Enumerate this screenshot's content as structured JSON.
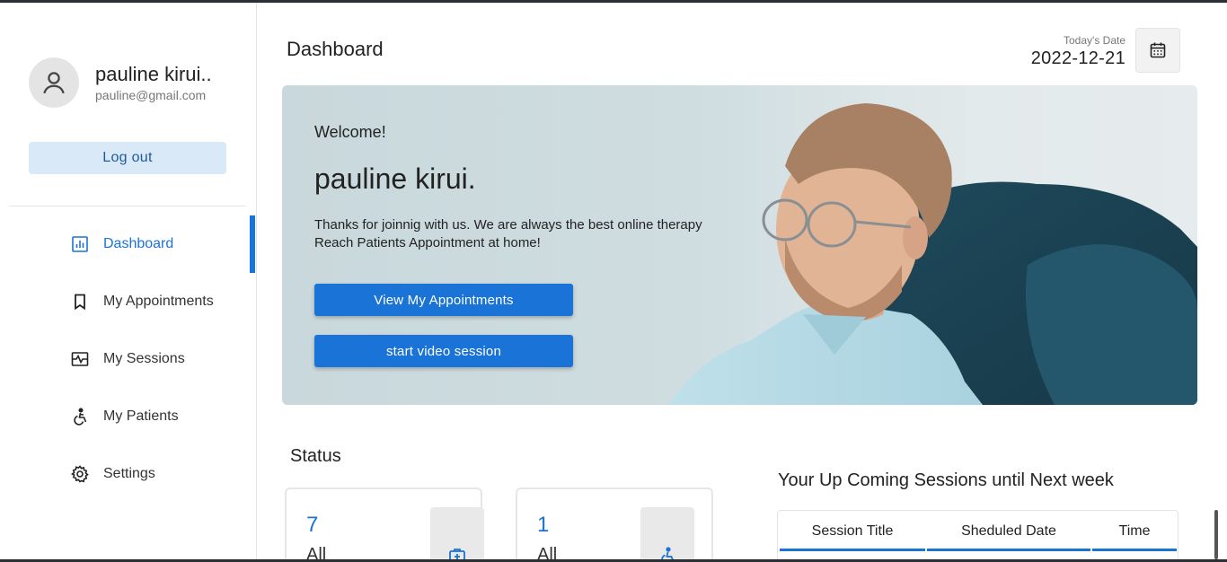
{
  "user": {
    "name": "pauline kirui..",
    "email": "pauline@gmail.com"
  },
  "sidebar": {
    "logout_label": "Log out",
    "items": [
      {
        "label": "Dashboard",
        "icon": "chart-icon",
        "active": true
      },
      {
        "label": "My Appointments",
        "icon": "bookmark-icon",
        "active": false
      },
      {
        "label": "My Sessions",
        "icon": "pulse-icon",
        "active": false
      },
      {
        "label": "My Patients",
        "icon": "accessible-icon",
        "active": false
      },
      {
        "label": "Settings",
        "icon": "gear-icon",
        "active": false
      }
    ]
  },
  "header": {
    "title": "Dashboard",
    "date_caption": "Today's Date",
    "date_value": "2022-12-21"
  },
  "hero": {
    "welcome": "Welcome!",
    "name": "pauline kirui.",
    "line1": "Thanks for joinnig with us. We are always the best online therapy",
    "line2": "Reach Patients Appointment at home!",
    "btn_appointments": "View My Appointments",
    "btn_video": "start video session"
  },
  "status": {
    "title": "Status",
    "cards": [
      {
        "count": "7",
        "label": "All"
      },
      {
        "count": "1",
        "label": "All"
      }
    ]
  },
  "upcoming": {
    "title": "Your Up Coming Sessions until Next week",
    "columns": [
      "Session Title",
      "Sheduled Date",
      "Time"
    ]
  },
  "colors": {
    "accent": "#1a73d6",
    "logout_bg": "#d9e9f8"
  }
}
